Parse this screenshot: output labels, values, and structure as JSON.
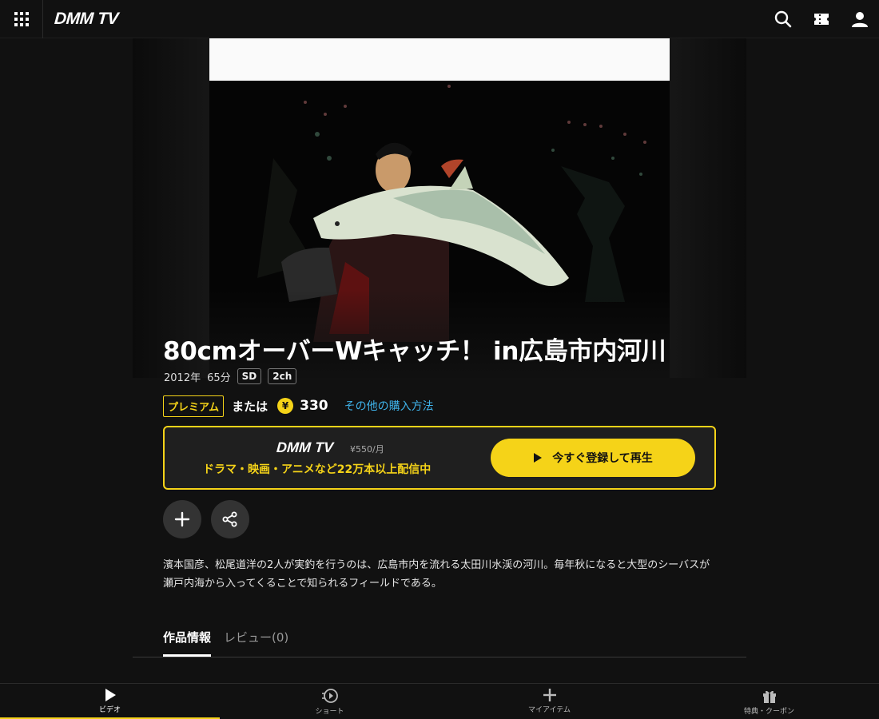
{
  "header": {
    "logo": "DMM TV",
    "icons": [
      "grid-menu-icon",
      "search-icon",
      "ticket-icon",
      "user-icon"
    ]
  },
  "video": {
    "title": "80cmオーバーWキャッチ！ in広島市内河川",
    "year": "2012年",
    "duration": "65分",
    "tags": [
      "SD",
      "2ch"
    ]
  },
  "pricing": {
    "premium_label": "プレミアム",
    "or_label": "または",
    "yen_symbol": "¥",
    "price": "330",
    "other_purchase_label": "その他の購入方法"
  },
  "promo": {
    "logo": "DMM TV",
    "monthly_price": "¥550/月",
    "tagline": "ドラマ・映画・アニメなど22万本以上配信中",
    "cta_label": "今すぐ登録して再生"
  },
  "description": "濱本国彦、松尾道洋の2人が実釣を行うのは、広島市内を流れる太田川水渓の河川。毎年秋になると大型のシーバスが瀬戸内海から入ってくることで知られるフィールドである。",
  "tabs": [
    {
      "label": "作品情報",
      "active": true
    },
    {
      "label": "レビュー(0)",
      "active": false
    }
  ],
  "bottom_nav": [
    {
      "label": "ビデオ",
      "icon": "play-icon",
      "active": true
    },
    {
      "label": "ショート",
      "icon": "short-play-icon",
      "active": false
    },
    {
      "label": "マイアイテム",
      "icon": "plus-icon",
      "active": false
    },
    {
      "label": "特典・クーポン",
      "icon": "gift-icon",
      "active": false
    }
  ],
  "colors": {
    "accent": "#f5d318",
    "link": "#3fb3ea",
    "background": "#111111"
  }
}
